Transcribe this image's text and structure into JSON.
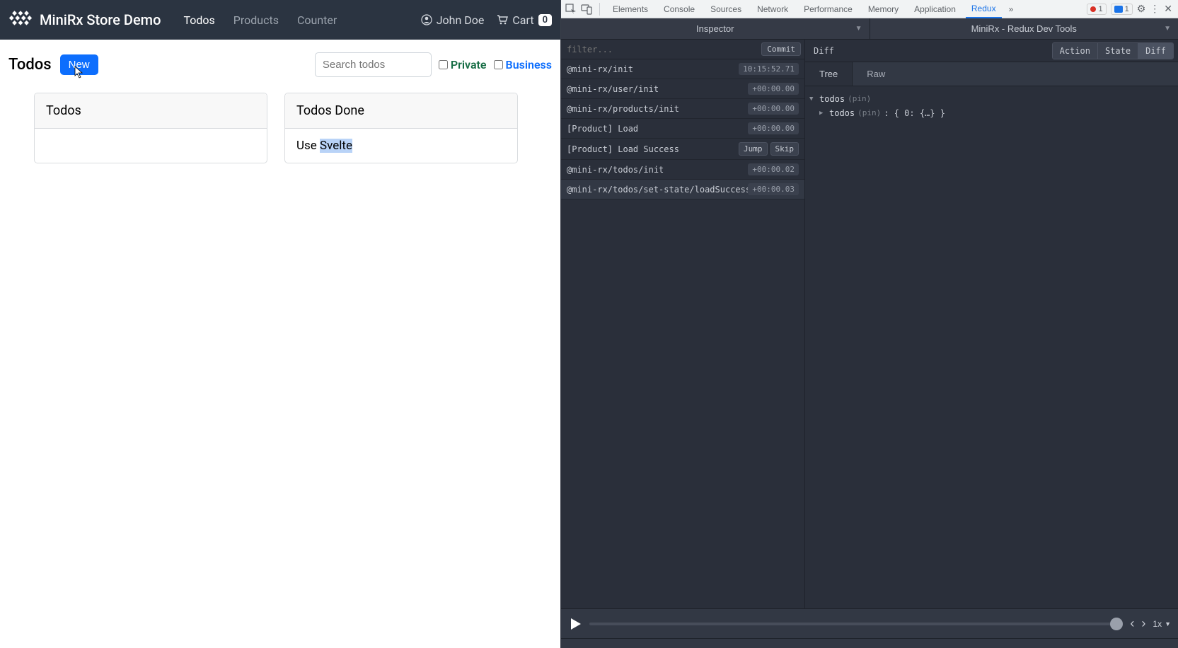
{
  "brand": "MiniRx Store Demo",
  "nav": {
    "items": [
      "Todos",
      "Products",
      "Counter"
    ],
    "activeIndex": 0
  },
  "user": {
    "name": "John Doe"
  },
  "cart": {
    "label": "Cart",
    "count": "0"
  },
  "page": {
    "title": "Todos",
    "newBtn": "New"
  },
  "search": {
    "placeholder": "Search todos"
  },
  "filters": {
    "private": "Private",
    "business": "Business"
  },
  "cards": {
    "open": {
      "title": "Todos",
      "items": []
    },
    "done": {
      "title": "Todos Done",
      "item_prefix": "Use ",
      "item_hl": "Svelte"
    }
  },
  "devtools": {
    "tabs": [
      "Elements",
      "Console",
      "Sources",
      "Network",
      "Performance",
      "Memory",
      "Application",
      "Redux"
    ],
    "activeTab": "Redux",
    "errors": "1",
    "messages": "1",
    "inspectorTitle": "Inspector",
    "panelTitle": "MiniRx - Redux Dev Tools",
    "filterPlaceholder": "filter...",
    "commit": "Commit",
    "actions": [
      {
        "name": "@mini-rx/init",
        "time": "10:15:52.71"
      },
      {
        "name": "@mini-rx/user/init",
        "time": "+00:00.00"
      },
      {
        "name": "@mini-rx/products/init",
        "time": "+00:00.00"
      },
      {
        "name": "[Product] Load",
        "time": "+00:00.00"
      },
      {
        "name": "[Product] Load Success",
        "jump": "Jump",
        "skip": "Skip",
        "hovered": true
      },
      {
        "name": "@mini-rx/todos/init",
        "time": "+00:00.02"
      },
      {
        "name": "@mini-rx/todos/set-state/loadSuccess",
        "time": "+00:00.03",
        "selected": true
      }
    ],
    "diffLabel": "Diff",
    "segs": [
      "Action",
      "State",
      "Diff"
    ],
    "activeSeg": "Diff",
    "fmtTabs": [
      "Tree",
      "Raw"
    ],
    "activeFmt": "Tree",
    "tree": {
      "root": "todos",
      "pin": "(pin)",
      "child": "todos",
      "childVal": ": { 0: {…} }"
    },
    "speed": "1x"
  }
}
